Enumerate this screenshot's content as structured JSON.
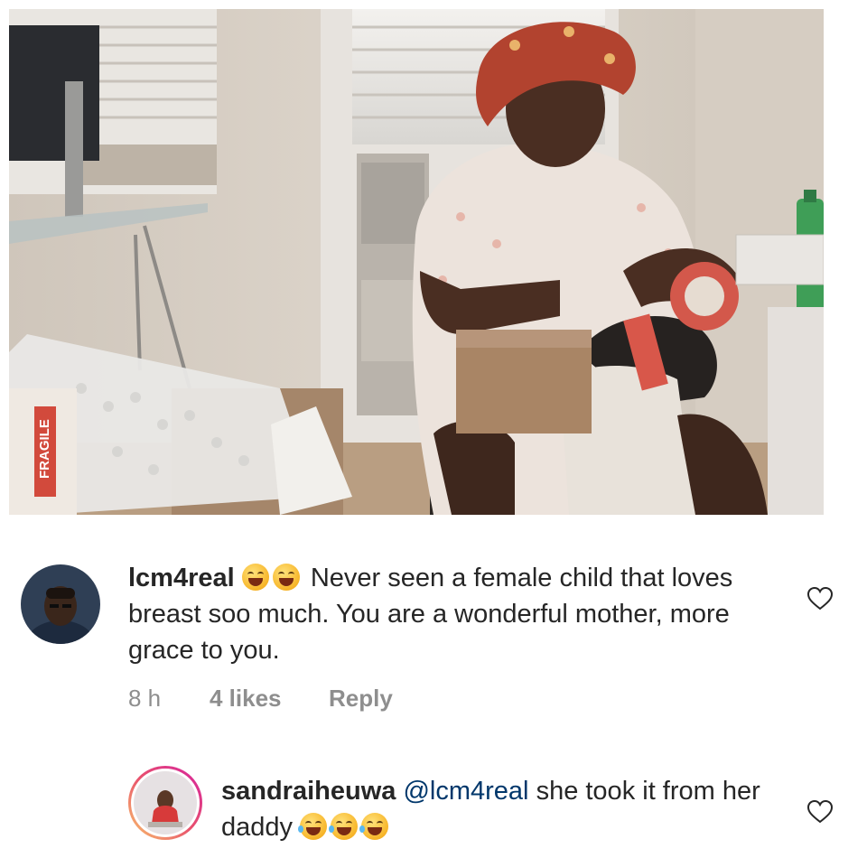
{
  "comments": [
    {
      "username": "lcm4real",
      "emoji_count": 2,
      "emoji_icon": "rolling-laughing-emoji",
      "text": "Never seen a female child that loves breast soo much. You are a wonderful mother, more grace to you.",
      "time": "8 h",
      "likes": "4 likes",
      "reply_label": "Reply",
      "like_icon": "heart-outline-icon"
    },
    {
      "username": "sandraiheuwa",
      "mention": "@lcm4real",
      "text": "she took it from her daddy",
      "emoji_count": 3,
      "emoji_icon": "tears-of-joy-emoji",
      "like_icon": "heart-outline-icon"
    }
  ],
  "photo": {
    "tape_label": "FRAGILE"
  },
  "colors": {
    "text": "#262626",
    "secondary_text": "#8e8e8e",
    "mention": "#00376b",
    "story_ring_start": "#f9c46b",
    "story_ring_end": "#d6249f"
  }
}
